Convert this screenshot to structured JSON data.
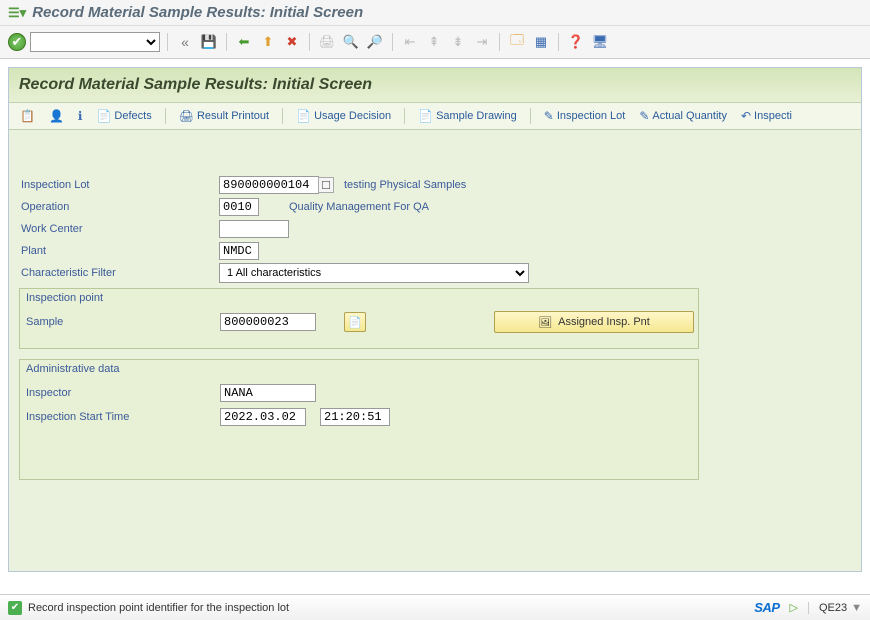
{
  "window": {
    "title": "Record Material Sample Results: Initial Screen"
  },
  "header": {
    "title": "Record Material Sample Results: Initial Screen"
  },
  "app_toolbar": {
    "defects": "Defects",
    "result_printout": "Result Printout",
    "usage_decision": "Usage Decision",
    "sample_drawing": "Sample Drawing",
    "inspection_lot": "Inspection Lot",
    "actual_quantity": "Actual Quantity",
    "inspection_cut": "Inspecti"
  },
  "form": {
    "inspection_lot_label": "Inspection Lot",
    "inspection_lot_value": "890000000104",
    "inspection_lot_desc": "testing Physical Samples",
    "operation_label": "Operation",
    "operation_value": "0010",
    "operation_desc": "Quality Management For QA",
    "work_center_label": "Work Center",
    "work_center_value": "",
    "plant_label": "Plant",
    "plant_value": "NMDC",
    "char_filter_label": "Characteristic Filter",
    "char_filter_value": "1 All characteristics"
  },
  "inspection_point": {
    "group_title": "Inspection point",
    "sample_label": "Sample",
    "sample_value": "800000023",
    "assigned_btn": "Assigned Insp. Pnt"
  },
  "admin": {
    "group_title": "Administrative data",
    "inspector_label": "Inspector",
    "inspector_value": "NANA",
    "start_time_label": "Inspection Start Time",
    "start_date_value": "2022.03.02",
    "start_time_value": "21:20:51"
  },
  "status": {
    "message": "Record inspection point identifier for the inspection lot",
    "tcode": "QE23",
    "sap": "SAP"
  }
}
